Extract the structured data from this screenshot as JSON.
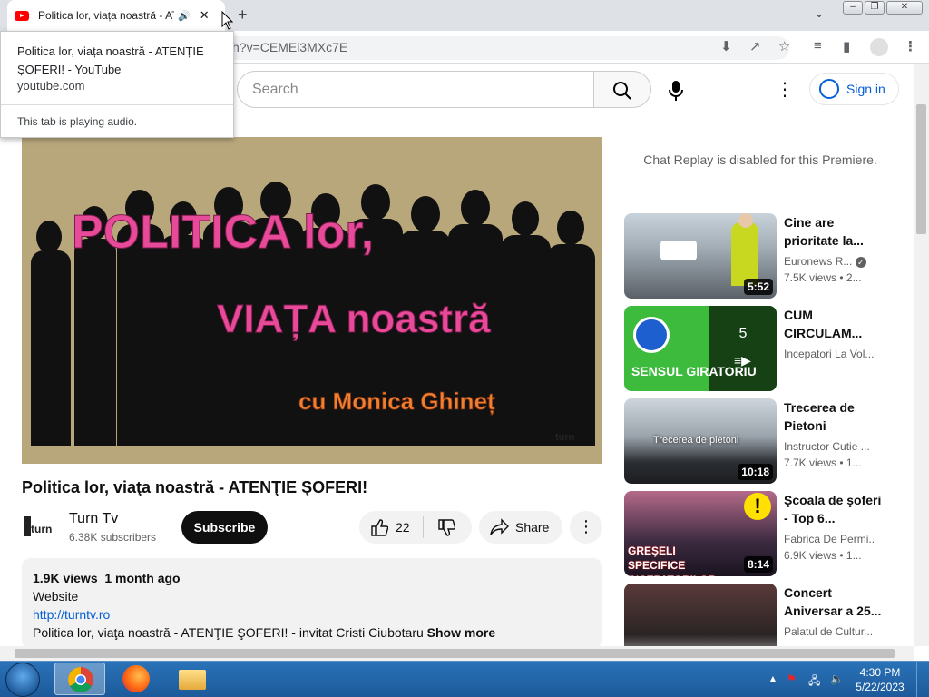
{
  "browser": {
    "tab_title": "Politica lor, viața noastră - ATENȚIE ȘOFERI! - YouTube",
    "tab_title_short": "Politica lor, viața noastră - AT",
    "url_fragment": "h?v=CEMEi3MXc7E"
  },
  "tab_popup": {
    "title": "Politica lor, viața noastră - ATENȚIE ȘOFERI! - YouTube",
    "domain": "youtube.com",
    "audio_status": "This tab is playing audio."
  },
  "youtube": {
    "search_placeholder": "Search",
    "sign_in": "Sign in"
  },
  "video": {
    "overlay_line1": "POLITICA lor,",
    "overlay_line2": "VIAȚA noastră",
    "overlay_line3": "cu Monica Ghineț",
    "watermark": "turn",
    "title": "Politica lor, viaţa noastră - ATENŢIE ŞOFERI!",
    "channel_name": "Turn  Tv",
    "subscribers": "6.38K subscribers",
    "subscribe_label": "Subscribe",
    "likes": "22",
    "share_label": "Share"
  },
  "description": {
    "stats": "1.9K views  1 month ago",
    "line1": "Website",
    "link": "http://turntv.ro",
    "line2": "Politica lor, viaţa noastră - ATENŢIE ŞOFERI! - invitat Cristi Ciubotaru",
    "show_more": "Show more"
  },
  "sidebar": {
    "chat_replay": "Chat Replay is disabled for this Premiere.",
    "videos": [
      {
        "title": "Cine are prioritate la...",
        "channel": "Euronews R...",
        "views": "7.5K views  • 2...",
        "duration": "5:52",
        "verified": true
      },
      {
        "title": "CUM CIRCULAM...",
        "channel": "Incepatori La Vol...",
        "views": "",
        "duration": "",
        "playlist_count": "5",
        "thumb_text": "SENSUL GIRATORIU"
      },
      {
        "title": "Trecerea de Pietoni",
        "channel": "Instructor Cutie ...",
        "views": "7.7K views  • 1...",
        "duration": "10:18",
        "thumb_text": "Trecerea de pietoni"
      },
      {
        "title": "Şcoala de şoferi - Top 6...",
        "channel": "Fabrica De Permi...",
        "views": "6.9K views  • 1...",
        "duration": "8:14",
        "thumb_text": "GREŞELI SPECIFICE INCEPATORILOR"
      },
      {
        "title": "Concert Aniversar a 25...",
        "channel": "Palatul de Cultur...",
        "views": "",
        "duration": ""
      }
    ]
  },
  "taskbar": {
    "time": "4:30 PM",
    "date": "5/22/2023"
  }
}
